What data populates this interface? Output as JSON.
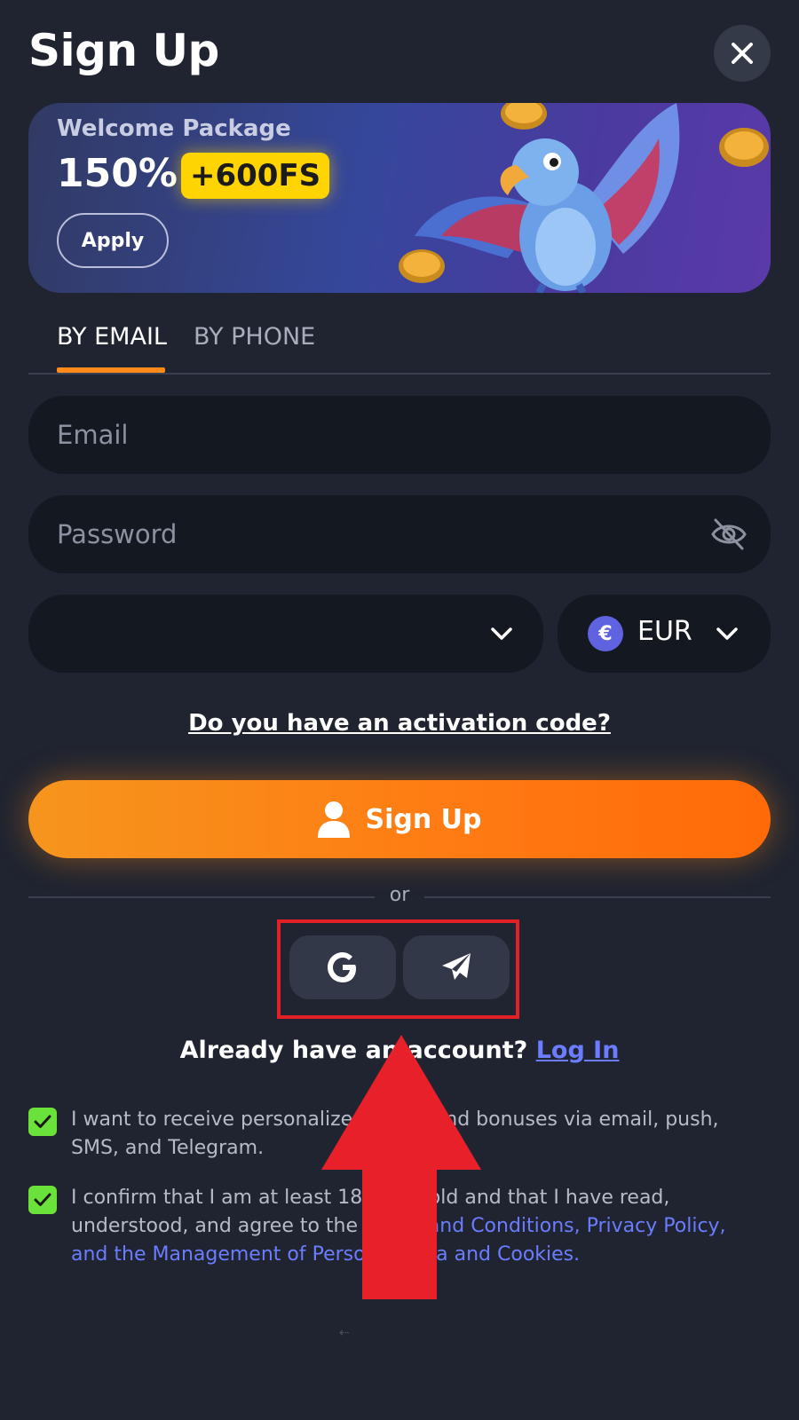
{
  "header": {
    "title": "Sign Up",
    "close_icon": "close-icon"
  },
  "banner": {
    "subtitle": "Welcome Package",
    "percent": "150%",
    "badge": "+600FS",
    "apply_label": "Apply",
    "badge_color": "#ffd400"
  },
  "tabs": [
    {
      "label": "BY EMAIL",
      "active": true
    },
    {
      "label": "BY PHONE",
      "active": false
    }
  ],
  "form": {
    "email_placeholder": "Email",
    "password_placeholder": "Password",
    "promo_value": "",
    "currency": "EUR",
    "currency_symbol": "€"
  },
  "activation_link": "Do you have an activation code?",
  "signup_button": "Sign Up",
  "or_text": "or",
  "social": [
    {
      "name": "google-icon"
    },
    {
      "name": "telegram-icon"
    }
  ],
  "login": {
    "prompt": "Already have an account?",
    "link": "Log In"
  },
  "consents": [
    {
      "text": "I want to receive personalized offers and bonuses via email, push, SMS, and Telegram.",
      "checked": true
    },
    {
      "text_before": "I confirm that I am at least 18 years old and that I have read, understood, and agree to the ",
      "link": "Terms and Conditions, Privacy Policy, and the Management of Personal Data and Cookies.",
      "checked": true
    }
  ],
  "colors": {
    "accent": "#ff8a1a",
    "link": "#6b7cff",
    "check": "#6be23a",
    "highlight": "#e32027"
  }
}
